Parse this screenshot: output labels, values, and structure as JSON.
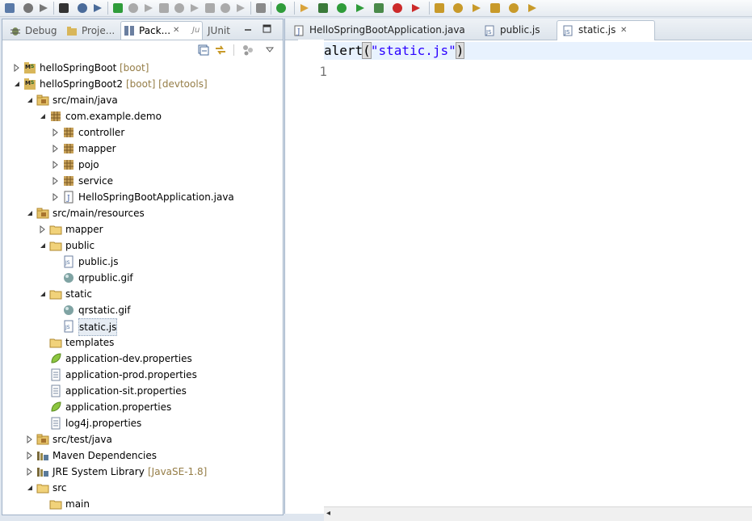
{
  "toolbar": {
    "buttons": [
      "new-wizard",
      "save",
      "save-all",
      "run-debug-profile",
      "console",
      "pin",
      "resume",
      "suspend",
      "terminate",
      "disconnect",
      "step-into",
      "step-over",
      "step-return",
      "drop-to-frame",
      "use-step-filters",
      "coverage",
      "spring-boot-dashboard",
      "eclipse-marketplace",
      "debug",
      "run",
      "run-coverage",
      "run-last-tool",
      "terminate-all",
      "relaunch",
      "open-type",
      "open-resource",
      "search",
      "open-folder",
      "next-annotation",
      "previous-annotation"
    ]
  },
  "left_panel": {
    "tabs": [
      {
        "label": "Debug",
        "icon": "bug-icon"
      },
      {
        "label": "Proje...",
        "icon": "project-icon"
      },
      {
        "label": "Pack...",
        "icon": "package-explorer-icon",
        "active": true,
        "close": "✕"
      },
      {
        "label": "JUnit",
        "icon": "junit-icon"
      }
    ],
    "tree": [
      {
        "label": "helloSpringBoot",
        "deco": "[boot]",
        "icon": "maven-project-icon",
        "level": 0,
        "twisty": "collapsed"
      },
      {
        "label": "helloSpringBoot2",
        "deco": "[boot] [devtools]",
        "icon": "maven-project-icon",
        "level": 0,
        "twisty": "expanded"
      },
      {
        "label": "src/main/java",
        "deco": "",
        "icon": "source-folder-icon",
        "level": 1,
        "twisty": "expanded"
      },
      {
        "label": "com.example.demo",
        "deco": "",
        "icon": "package-icon",
        "level": 2,
        "twisty": "expanded"
      },
      {
        "label": "controller",
        "deco": "",
        "icon": "package-icon",
        "level": 3,
        "twisty": "collapsed"
      },
      {
        "label": "mapper",
        "deco": "",
        "icon": "package-icon",
        "level": 3,
        "twisty": "collapsed"
      },
      {
        "label": "pojo",
        "deco": "",
        "icon": "package-icon",
        "level": 3,
        "twisty": "collapsed"
      },
      {
        "label": "service",
        "deco": "",
        "icon": "package-icon",
        "level": 3,
        "twisty": "collapsed"
      },
      {
        "label": "HelloSpringBootApplication.java",
        "deco": "",
        "icon": "java-file-icon",
        "level": 3,
        "twisty": "collapsed"
      },
      {
        "label": "src/main/resources",
        "deco": "",
        "icon": "source-folder-icon",
        "level": 1,
        "twisty": "expanded"
      },
      {
        "label": "mapper",
        "deco": "",
        "icon": "folder-icon",
        "level": 2,
        "twisty": "collapsed"
      },
      {
        "label": "public",
        "deco": "",
        "icon": "folder-icon",
        "level": 2,
        "twisty": "expanded"
      },
      {
        "label": "public.js",
        "deco": "",
        "icon": "js-file-icon",
        "level": 3,
        "twisty": "none"
      },
      {
        "label": "qrpublic.gif",
        "deco": "",
        "icon": "image-file-icon",
        "level": 3,
        "twisty": "none"
      },
      {
        "label": "static",
        "deco": "",
        "icon": "folder-icon",
        "level": 2,
        "twisty": "expanded"
      },
      {
        "label": "qrstatic.gif",
        "deco": "",
        "icon": "image-file-icon",
        "level": 3,
        "twisty": "none"
      },
      {
        "label": "static.js",
        "deco": "",
        "icon": "js-file-icon",
        "level": 3,
        "twisty": "none",
        "selected": true
      },
      {
        "label": "templates",
        "deco": "",
        "icon": "folder-icon",
        "level": 2,
        "twisty": "none"
      },
      {
        "label": "application-dev.properties",
        "deco": "",
        "icon": "spring-properties-icon",
        "level": 2,
        "twisty": "none"
      },
      {
        "label": "application-prod.properties",
        "deco": "",
        "icon": "text-file-icon",
        "level": 2,
        "twisty": "none"
      },
      {
        "label": "application-sit.properties",
        "deco": "",
        "icon": "text-file-icon",
        "level": 2,
        "twisty": "none"
      },
      {
        "label": "application.properties",
        "deco": "",
        "icon": "spring-properties-icon",
        "level": 2,
        "twisty": "none"
      },
      {
        "label": "log4j.properties",
        "deco": "",
        "icon": "text-file-icon",
        "level": 2,
        "twisty": "none"
      },
      {
        "label": "src/test/java",
        "deco": "",
        "icon": "source-folder-icon",
        "level": 1,
        "twisty": "collapsed"
      },
      {
        "label": "Maven Dependencies",
        "deco": "",
        "icon": "library-icon",
        "level": 1,
        "twisty": "collapsed"
      },
      {
        "label": "JRE System Library",
        "deco": "[JavaSE-1.8]",
        "icon": "library-icon",
        "level": 1,
        "twisty": "collapsed"
      },
      {
        "label": "src",
        "deco": "",
        "icon": "folder-icon",
        "level": 1,
        "twisty": "expanded"
      },
      {
        "label": "main",
        "deco": "",
        "icon": "folder-icon",
        "level": 2,
        "twisty": "none"
      }
    ]
  },
  "editor": {
    "tabs": [
      {
        "label": "HelloSpringBootApplication.java",
        "icon": "java-file-icon"
      },
      {
        "label": "public.js",
        "icon": "js-file-icon"
      },
      {
        "label": "static.js",
        "icon": "js-file-icon",
        "active": true,
        "close": "✕"
      }
    ],
    "line_number": "1",
    "code": {
      "fn": "alert",
      "open_paren": "(",
      "string": "\"static.js\"",
      "close_paren": ")"
    }
  },
  "colors": {
    "decoration": "#957d47",
    "string": "#2a00ff",
    "current_line": "#e8f2fe"
  }
}
